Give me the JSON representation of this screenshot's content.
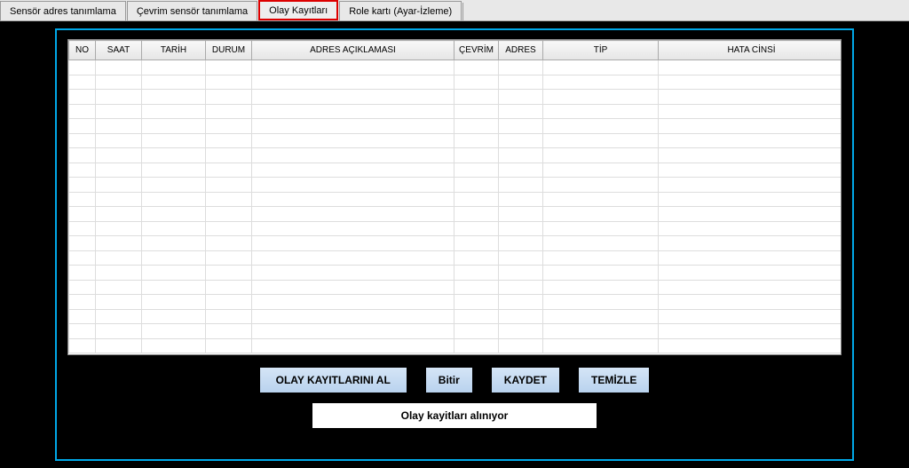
{
  "tabs": {
    "sensor_address": "Sensör adres tanımlama",
    "cevrim_sensor": "Çevrim sensör tanımlama",
    "olay_kayitlari": "Olay Kayıtları",
    "role_karti": "Role kartı (Ayar-İzleme)"
  },
  "table": {
    "headers": {
      "no": "NO",
      "saat": "SAAT",
      "tarih": "TARİH",
      "durum": "DURUM",
      "adres_aciklamasi": "ADRES AÇIKLAMASI",
      "cevrim": "ÇEVRİM",
      "adres": "ADRES",
      "tip": "TİP",
      "hata_cinsi": "HATA CİNSİ"
    }
  },
  "buttons": {
    "get_records": "OLAY KAYITLARINI AL",
    "finish": "Bitir",
    "save": "KAYDET",
    "clear": "TEMİZLE"
  },
  "status": {
    "message": "Olay kayitları alınıyor"
  }
}
